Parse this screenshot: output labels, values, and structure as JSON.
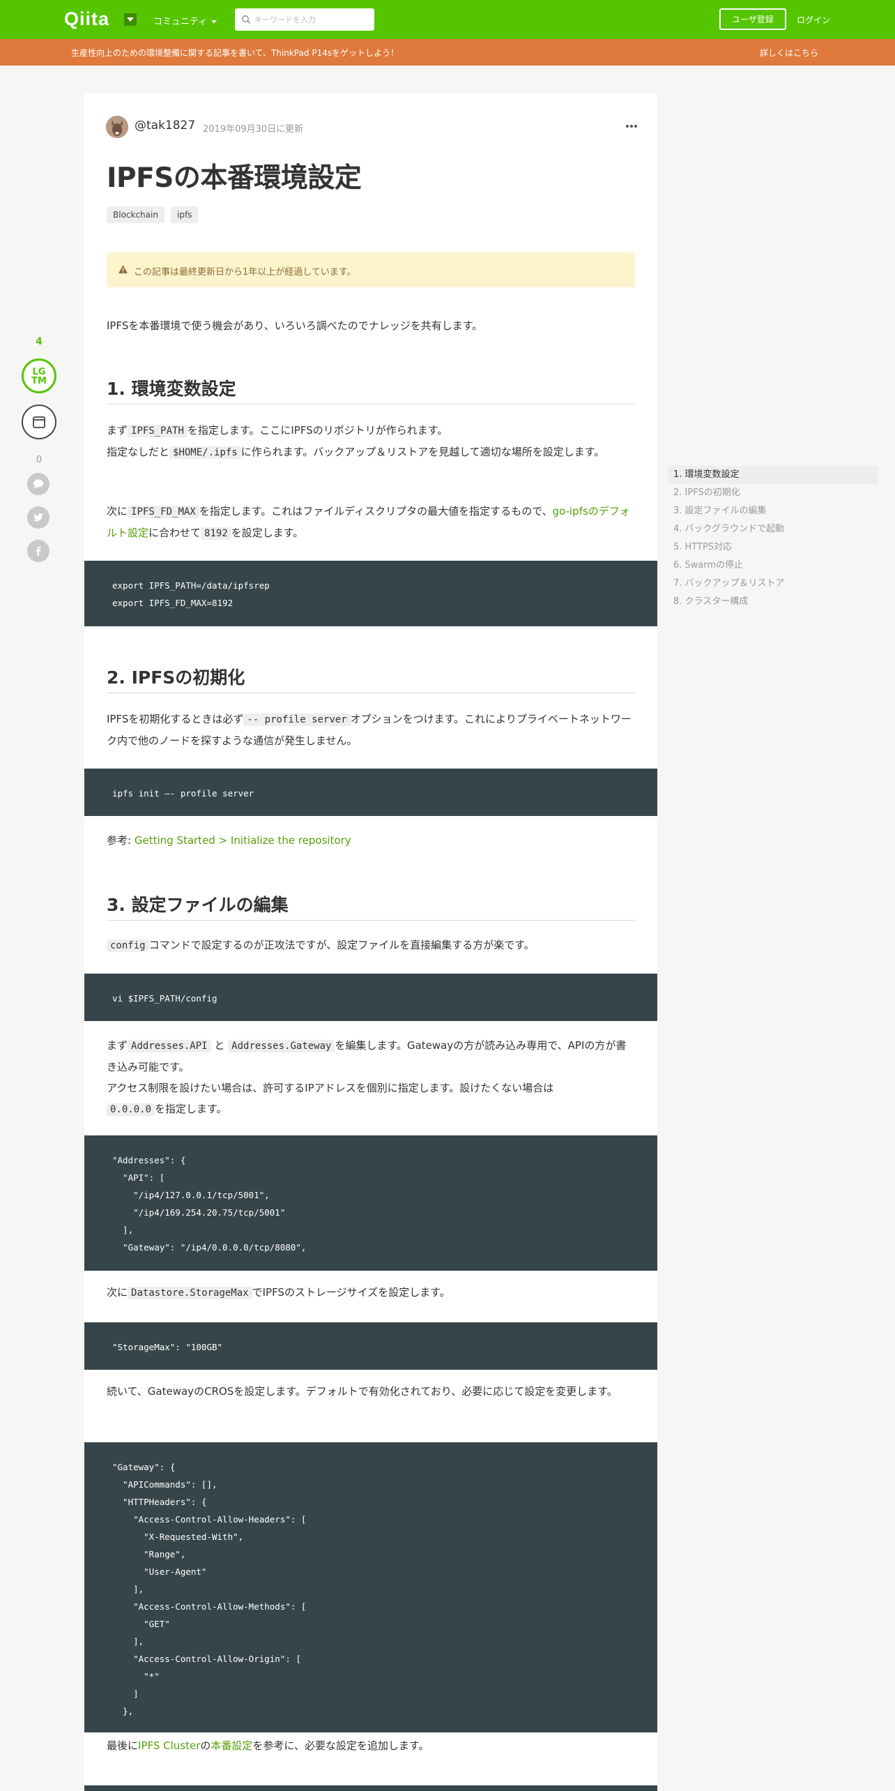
{
  "header": {
    "logo": "Qiita",
    "community": "コミュニティ",
    "search_placeholder": "キーワードを入力",
    "signup": "ユーザ登録",
    "login": "ログイン",
    "brand_color": "#55c500"
  },
  "banner": {
    "text": "生産性向上のための環境整備に関する記事を書いて、ThinkPad P14sをゲットしよう！",
    "link": "詳しくはこちら",
    "color": "#e07a3c"
  },
  "actions": {
    "lgtm_count": "4",
    "lgtm_label_1": "LG",
    "lgtm_label_2": "TM",
    "comment_count": "0"
  },
  "article": {
    "author": "@tak1827",
    "updated": "2019年09月30日に更新",
    "title": "IPFSの本番環境設定",
    "tags": [
      "Blockchain",
      "ipfs"
    ],
    "notice": "この記事は最終更新日から1年以上が経過しています。",
    "intro": "IPFSを本番環境で使う機会があり、いろいろ調べたのでナレッジを共有します。",
    "s1": {
      "heading": "1. 環境変数設定",
      "p1a": "まず",
      "p1code": "IPFS_PATH",
      "p1b": "を指定します。ここにIPFSのリポジトリが作られます。",
      "p1c": "指定なしだと",
      "p1code2": "$HOME/.ipfs",
      "p1d": "に作られます。バックアップ＆リストアを見越して適切な場所を設定します。",
      "p2a": "次に",
      "p2code": "IPFS_FD_MAX",
      "p2b": "を指定します。これはファイルディスクリプタの最大値を指定するもので、",
      "p2link": "go-ipfsのデフォルト設定",
      "p2c": "に合わせて",
      "p2code2": "8192",
      "p2d": "を設定します。",
      "code": "export IPFS_PATH=/data/ipfsrep\nexport IPFS_FD_MAX=8192"
    },
    "s2": {
      "heading": "2. IPFSの初期化",
      "p1a": "IPFSを初期化するときは必ず",
      "p1code": "-- profile server",
      "p1b": "オプションをつけます。これによりプライベートネットワーク内で他のノードを探すような通信が発生しません。",
      "code": "ipfs init —- profile server",
      "ref_label": "参考:",
      "ref_link": "Getting Started > Initialize the repository"
    },
    "s3": {
      "heading": "3. 設定ファイルの編集",
      "p1code": "config",
      "p1b": "コマンドで設定するのが正攻法ですが、設定ファイルを直接編集する方が楽です。",
      "code1": "vi $IPFS_PATH/config",
      "p2a": "まず",
      "p2code": "Addresses.API",
      "p2and": "と",
      "p2code2": "Addresses.Gateway",
      "p2b": "を編集します。Gatewayの方が読み込み専用で、APIの方が書き込み可能です。",
      "p2c": "アクセス制限を設けたい場合は、許可するIPアドレスを個別に指定します。設けたくない場合は",
      "p2code3": "0.0.0.0",
      "p2d": "を指定します。",
      "code2": "\"Addresses\": {\n  \"API\": [\n    \"/ip4/127.0.0.1/tcp/5001\",\n    \"/ip4/169.254.20.75/tcp/5001\"\n  ],\n  \"Gateway\": \"/ip4/0.0.0.0/tcp/8080\",",
      "p3a": "次に",
      "p3code": "Datastore.StorageMax",
      "p3b": "でIPFSのストレージサイズを設定します。",
      "code3": "\"StorageMax\": \"100GB\"",
      "p4": "続いて、GatewayのCROSを設定します。デフォルトで有効化されており、必要に応じて設定を変更します。",
      "code4": "\"Gateway\": {\n  \"APICommands\": [],\n  \"HTTPHeaders\": {\n    \"Access-Control-Allow-Headers\": [\n      \"X-Requested-With\",\n      \"Range\",\n      \"User-Agent\"\n    ],\n    \"Access-Control-Allow-Methods\": [\n      \"GET\"\n    ],\n    \"Access-Control-Allow-Origin\": [\n      \"*\"\n    ]\n  },",
      "p5a": "最後に",
      "p5link": "IPFS Cluster",
      "p5b": "の",
      "p5link2": "本番設定",
      "p5c": "を参考に、必要な設定を追加します。"
    }
  },
  "toc": {
    "items": [
      "1. 環境変数設定",
      "2. IPFSの初期化",
      "3. 設定ファイルの編集",
      "4. バックグラウンドで起動",
      "5. HTTPS対応",
      "6. Swarmの停止",
      "7. バックアップ＆リストア",
      "8. クラスター構成"
    ]
  }
}
